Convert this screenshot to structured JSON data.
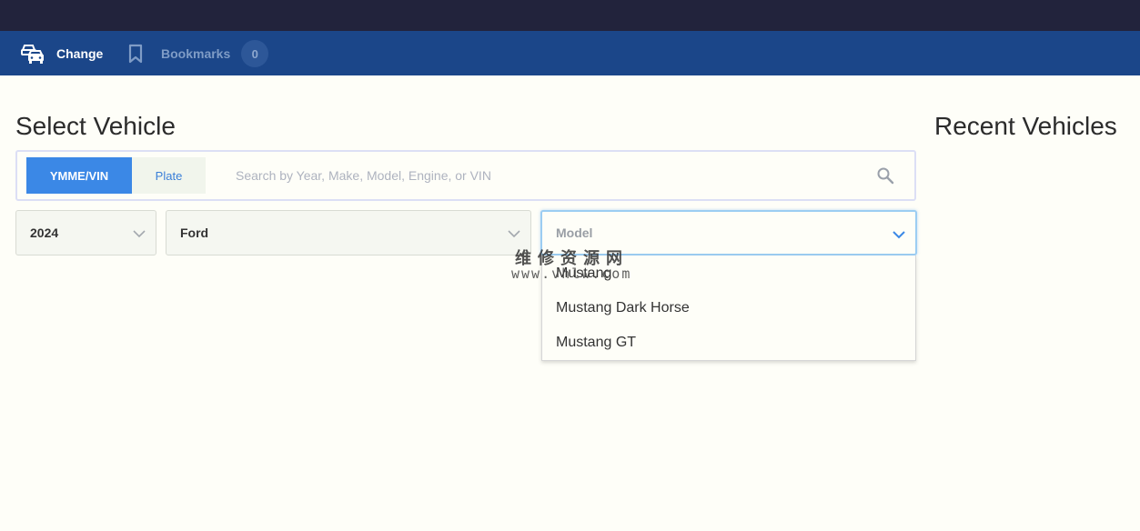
{
  "nav": {
    "change_label": "Change",
    "bookmarks_label": "Bookmarks",
    "bookmarks_count": "0",
    "icons": {
      "change": "car-swap-icon",
      "bookmarks": "bookmark-icon"
    },
    "colors": {
      "top_bar": "#22233c",
      "nav_bar": "#1b4689"
    }
  },
  "main": {
    "title": "Select Vehicle",
    "recent_title": "Recent Vehicles"
  },
  "search": {
    "tab_ymme": "YMME/VIN",
    "tab_plate": "Plate",
    "placeholder": "Search by Year, Make, Model, Engine, or VIN",
    "icon": "search-icon",
    "accent": "#3b88e6"
  },
  "selects": {
    "year": "2024",
    "make": "Ford",
    "model_placeholder": "Model"
  },
  "dropdown": {
    "options": [
      "Mustang",
      "Mustang Dark Horse",
      "Mustang GT"
    ]
  },
  "watermark": {
    "line1": "维修资源网",
    "line2": "www.vhlw.com"
  }
}
